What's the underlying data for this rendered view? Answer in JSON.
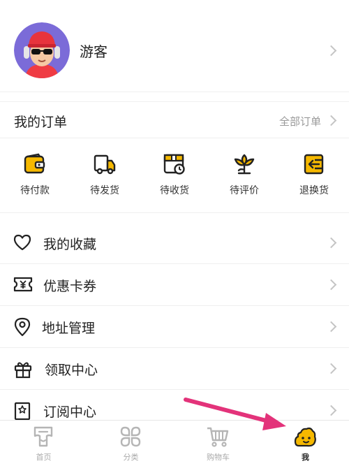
{
  "profile": {
    "username": "游客"
  },
  "orders": {
    "title": "我的订单",
    "all_label": "全部订单",
    "items": [
      {
        "label": "待付款",
        "icon": "wallet-icon"
      },
      {
        "label": "待发货",
        "icon": "truck-icon"
      },
      {
        "label": "待收货",
        "icon": "package-clock-icon"
      },
      {
        "label": "待评价",
        "icon": "flower-icon"
      },
      {
        "label": "退换货",
        "icon": "return-icon"
      }
    ]
  },
  "menu": [
    {
      "label": "我的收藏",
      "icon": "heart-icon"
    },
    {
      "label": "优惠卡券",
      "icon": "coupon-icon"
    },
    {
      "label": "地址管理",
      "icon": "location-pin-icon"
    },
    {
      "label": "领取中心",
      "icon": "gift-icon"
    },
    {
      "label": "订阅中心",
      "icon": "subscribe-icon"
    }
  ],
  "tabbar": {
    "tabs": [
      {
        "label": "首页",
        "icon": "home-icon"
      },
      {
        "label": "分类",
        "icon": "category-icon"
      },
      {
        "label": "购物车",
        "icon": "cart-icon"
      },
      {
        "label": "我",
        "icon": "me-face-icon",
        "active": true
      }
    ]
  },
  "colors": {
    "accent": "#f5b800",
    "annotation_arrow": "#e3337a"
  }
}
